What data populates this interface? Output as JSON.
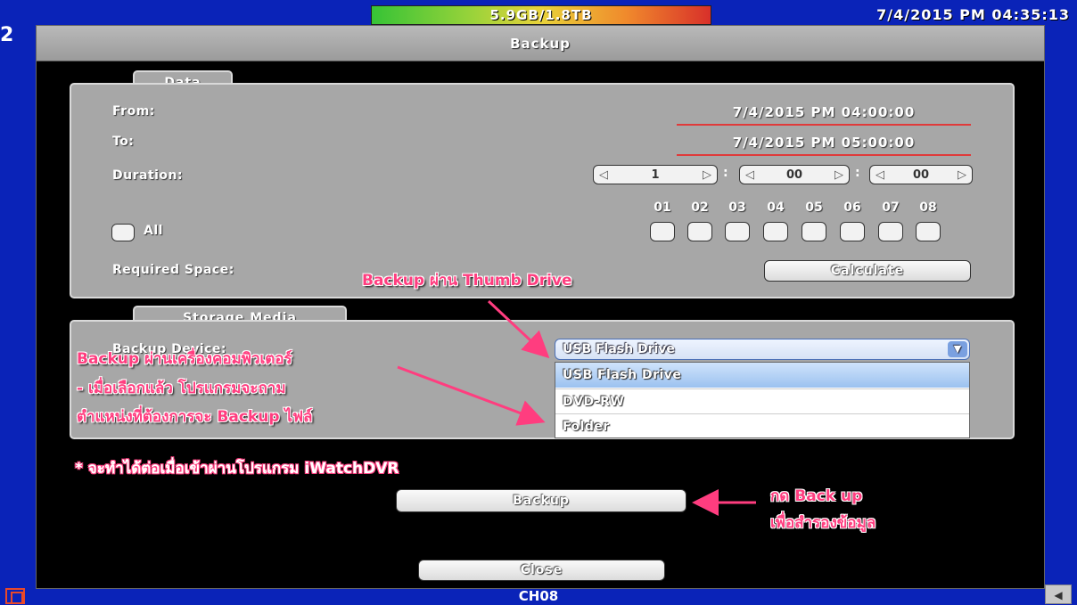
{
  "status": {
    "storage_usage": "5.9GB/1.8TB",
    "clock": "7/4/2015 PM 04:35:13",
    "left_digit": "2",
    "channel": "CH08"
  },
  "dialog": {
    "title": "Backup",
    "data_section": {
      "tab": "Data",
      "from_label": "From:",
      "from_value": "7/4/2015 PM 04:00:00",
      "to_label": "To:",
      "to_value": "7/4/2015 PM 05:00:00",
      "duration_label": "Duration:",
      "duration_hours": "1",
      "duration_minutes": "00",
      "duration_seconds": "00",
      "separator": ":",
      "left_arrow": "◁",
      "right_arrow": "▷",
      "all_label": "All",
      "channels": [
        "01",
        "02",
        "03",
        "04",
        "05",
        "06",
        "07",
        "08"
      ],
      "required_space_label": "Required Space:",
      "calculate_button": "Calculate"
    },
    "storage_section": {
      "tab": "Storage Media",
      "backup_device_label": "Backup Device:",
      "selected_device": "USB Flash Drive",
      "device_options": [
        "USB Flash Drive",
        "DVD-RW",
        "Folder"
      ]
    },
    "backup_button": "Backup",
    "close_button": "Close"
  },
  "annotations": {
    "thumb_drive": "Backup ผ่าน Thumb Drive",
    "computer_line1": "Backup ผ่านเครื่องคอมพิวเตอร์",
    "computer_line2": "- เมื่อเลือกแล้ว โปรแกรมจะถาม",
    "computer_line3": "ตำแหน่งที่ต้องการจะ Backup ไฟล์",
    "iwatch_note": "* จะทำได้ต่อเมื่อเข้าผ่านโปรแกรม iWatchDVR",
    "press_backup_line1": "กด Back up",
    "press_backup_line2": "เพื่อสำรองข้อมูล"
  },
  "colors": {
    "background": "#0a23b8",
    "annotation": "#ff3d7f",
    "date_underline": "#e03a3a"
  }
}
